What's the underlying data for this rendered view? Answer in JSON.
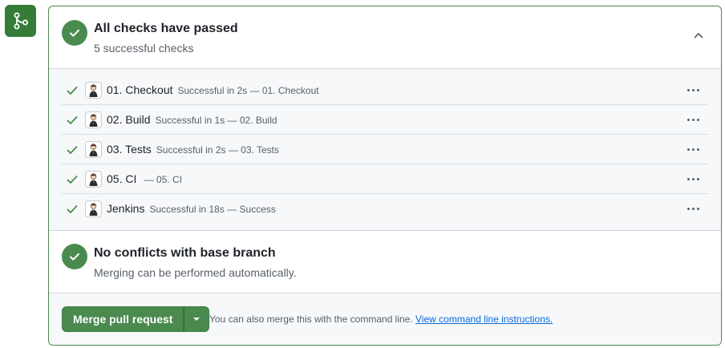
{
  "icons": {
    "merge": "git-merge-icon",
    "check": "check-icon",
    "collapse": "chevron-up-icon",
    "caret": "triangle-down-icon",
    "kebab": "kebab-horizontal-icon",
    "avatar": "jenkins-avatar-icon"
  },
  "colors": {
    "success": "#4b8a4f",
    "badge": "#347d39",
    "link": "#0969da",
    "muted": "#57606a"
  },
  "summary": {
    "title": "All checks have passed",
    "subtitle": "5 successful checks"
  },
  "checks": [
    {
      "name": "01. Checkout",
      "description": "Successful in 2s — 01. Checkout"
    },
    {
      "name": "02. Build",
      "description": "Successful in 1s — 02. Build"
    },
    {
      "name": "03. Tests",
      "description": "Successful in 2s — 03. Tests"
    },
    {
      "name": "05. CI",
      "description": " — 05. CI"
    },
    {
      "name": "Jenkins",
      "description": "Successful in 18s — Success"
    }
  ],
  "conflicts": {
    "title": "No conflicts with base branch",
    "subtitle": "Merging can be performed automatically."
  },
  "merge": {
    "button_label": "Merge pull request",
    "hint_text": "You can also merge this with the command line.",
    "hint_link": "View command line instructions."
  }
}
